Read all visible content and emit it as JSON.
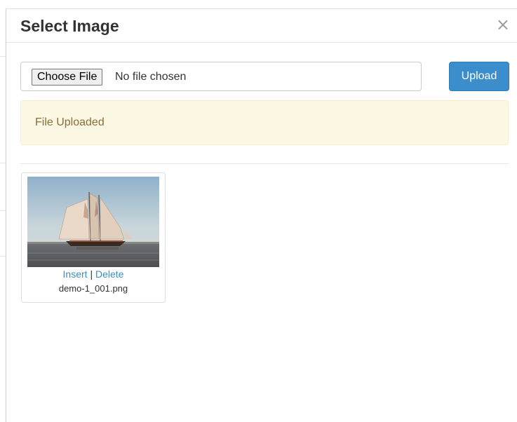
{
  "modal": {
    "title": "Select Image",
    "close_label": "×"
  },
  "file_input": {
    "button_label": "Choose File",
    "status_text": "No file chosen"
  },
  "upload_button": {
    "label": "Upload"
  },
  "alert": {
    "message": "File Uploaded"
  },
  "images": [
    {
      "insert_label": "Insert",
      "separator": "|",
      "delete_label": "Delete",
      "filename": "demo-1_001.png"
    }
  ],
  "colors": {
    "primary": "#3c8dcb",
    "link": "#3c8dbc",
    "alert_bg": "#fcf8e3",
    "alert_text": "#8a6d3b"
  }
}
